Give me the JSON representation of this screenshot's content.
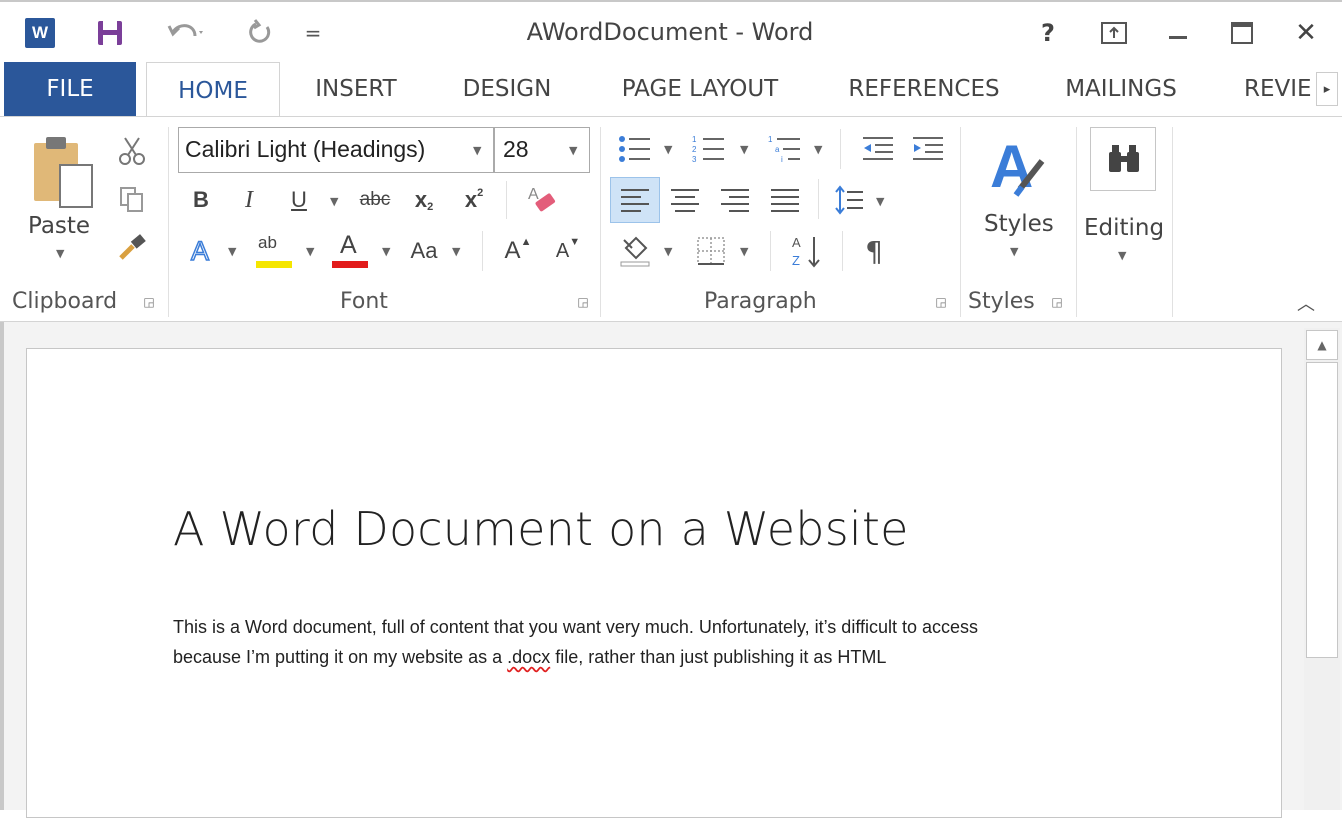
{
  "window": {
    "title": "AWordDocument - Word",
    "help_label": "?",
    "close_label": "✕"
  },
  "quick_access": {
    "app_icon_label": "W",
    "customize_label": "="
  },
  "tabs": [
    {
      "label": "FILE"
    },
    {
      "label": "HOME"
    },
    {
      "label": "INSERT"
    },
    {
      "label": "DESIGN"
    },
    {
      "label": "PAGE LAYOUT"
    },
    {
      "label": "REFERENCES"
    },
    {
      "label": "MAILINGS"
    },
    {
      "label": "REVIE"
    }
  ],
  "ribbon": {
    "clipboard": {
      "paste_label": "Paste",
      "group_label": "Clipboard"
    },
    "font": {
      "font_name": "Calibri Light (Headings)",
      "font_size": "28",
      "bold": "B",
      "italic": "I",
      "underline": "U",
      "strikethrough": "abc",
      "subscript": "x",
      "superscript": "x",
      "text_effects": "A",
      "highlight": "ab",
      "font_color": "A",
      "change_case": "Aa",
      "grow_font": "A",
      "shrink_font": "A",
      "group_label": "Font",
      "highlight_color": "#f5e600",
      "font_color_bar": "#e21b1b"
    },
    "paragraph": {
      "sort_label": "A Z",
      "pilcrow": "¶",
      "group_label": "Paragraph"
    },
    "styles": {
      "styles_label": "Styles",
      "group_label": "Styles"
    },
    "editing": {
      "editing_label": "Editing"
    }
  },
  "document": {
    "heading": "A Word Document on a Website",
    "line1": "This is a Word document, full of content that you want very much. Unfortunately, it’s difficult to access",
    "line2_before": "because I’m putting it on my website as a ",
    "line2_misspelled": ".docx",
    "line2_after": " file, rather than just publishing it as HTML"
  },
  "colors": {
    "accent": "#2b579a",
    "word_blue": "#2b579a",
    "misspell_underline": "#e02020"
  }
}
